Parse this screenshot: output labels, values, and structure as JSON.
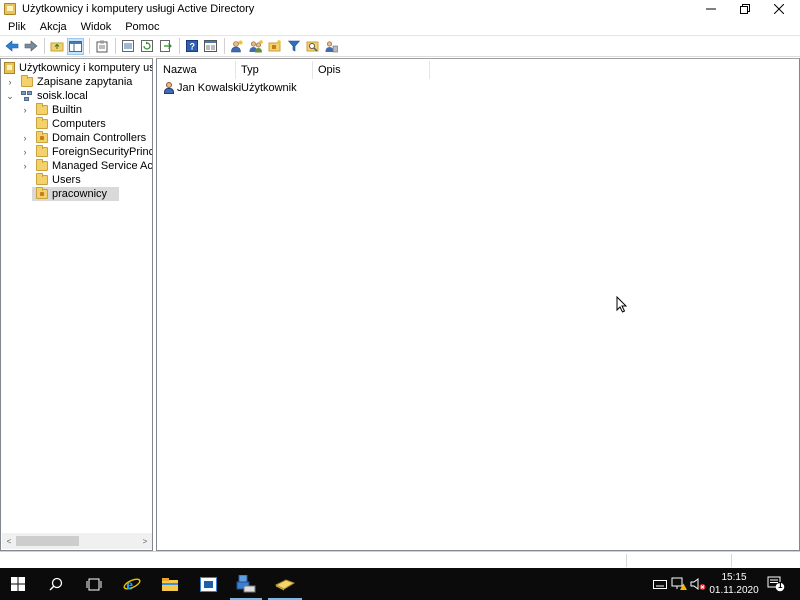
{
  "window": {
    "title": "Użytkownicy i komputery usługi Active Directory",
    "controls": {
      "minimize": "—",
      "restore": "❐",
      "close": "✕"
    }
  },
  "menu": [
    "Plik",
    "Akcja",
    "Widok",
    "Pomoc"
  ],
  "toolbar": {
    "icons": [
      "back-icon",
      "forward-icon",
      "up-folder-icon",
      "show-hide-console-tree-icon",
      "properties-icon",
      "export-list-icon",
      "refresh-icon",
      "help-icon",
      "console-view-icon",
      "new-user-icon",
      "new-group-icon",
      "new-ou-icon",
      "filter-icon",
      "find-icon",
      "add-to-group-icon"
    ]
  },
  "tree": {
    "root": "Użytkownicy i komputery usługi",
    "items": [
      {
        "label": "Zapisane zapytania",
        "expander": "›"
      },
      {
        "label": "soisk.local",
        "expander": "⌄"
      },
      {
        "label": "Builtin",
        "expander": "›"
      },
      {
        "label": "Computers",
        "expander": ""
      },
      {
        "label": "Domain Controllers",
        "expander": "›"
      },
      {
        "label": "ForeignSecurityPrincipals",
        "expander": "›"
      },
      {
        "label": "Managed Service Accour",
        "expander": "›"
      },
      {
        "label": "Users",
        "expander": ""
      },
      {
        "label": "pracownicy",
        "expander": ""
      }
    ],
    "scroll_left": "<",
    "scroll_right": ">"
  },
  "list": {
    "columns": [
      "Nazwa",
      "Typ",
      "Opis"
    ],
    "rows": [
      {
        "name": "Jan Kowalski",
        "type": "Użytkownik",
        "desc": ""
      }
    ]
  },
  "taskbar": {
    "clock_time": "15:15",
    "clock_date": "01.11.2020",
    "notification_count": "1"
  }
}
